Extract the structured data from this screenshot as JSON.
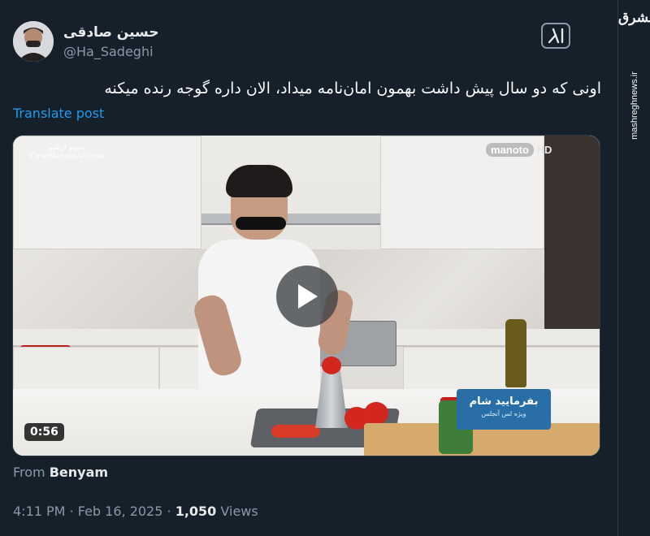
{
  "author": {
    "name": "حسین صادقی",
    "handle": "@Ha_Sadeghi"
  },
  "tweet": {
    "text": "اونی که دو سال پیش داشت بهمون امان‌نامه میداد، الان داره گوجه رنده میکنه",
    "translate_label": "Translate post"
  },
  "side": {
    "logo_text": "مشرق",
    "watermark": "mashreghnews.ir"
  },
  "video": {
    "duration": "0:56",
    "channel": "manoto",
    "channel_suffix": "HD",
    "archive_line1": "منوتو آرشیو",
    "archive_line2": "T.me/ManotoArchive",
    "show_title": "بفرمایید شام",
    "show_subtitle": "ویژه لس آنجلس"
  },
  "attribution": {
    "prefix": "From",
    "source": "Benyam"
  },
  "meta": {
    "time": "4:11 PM",
    "separator": "·",
    "date": "Feb 16, 2025",
    "views_count": "1,050",
    "views_label": "Views"
  },
  "colors": {
    "background": "#15202b",
    "link": "#1d9bf0",
    "secondary_text": "#8b98a5"
  },
  "icons": {
    "grok": "grok-icon",
    "play": "play-icon"
  }
}
